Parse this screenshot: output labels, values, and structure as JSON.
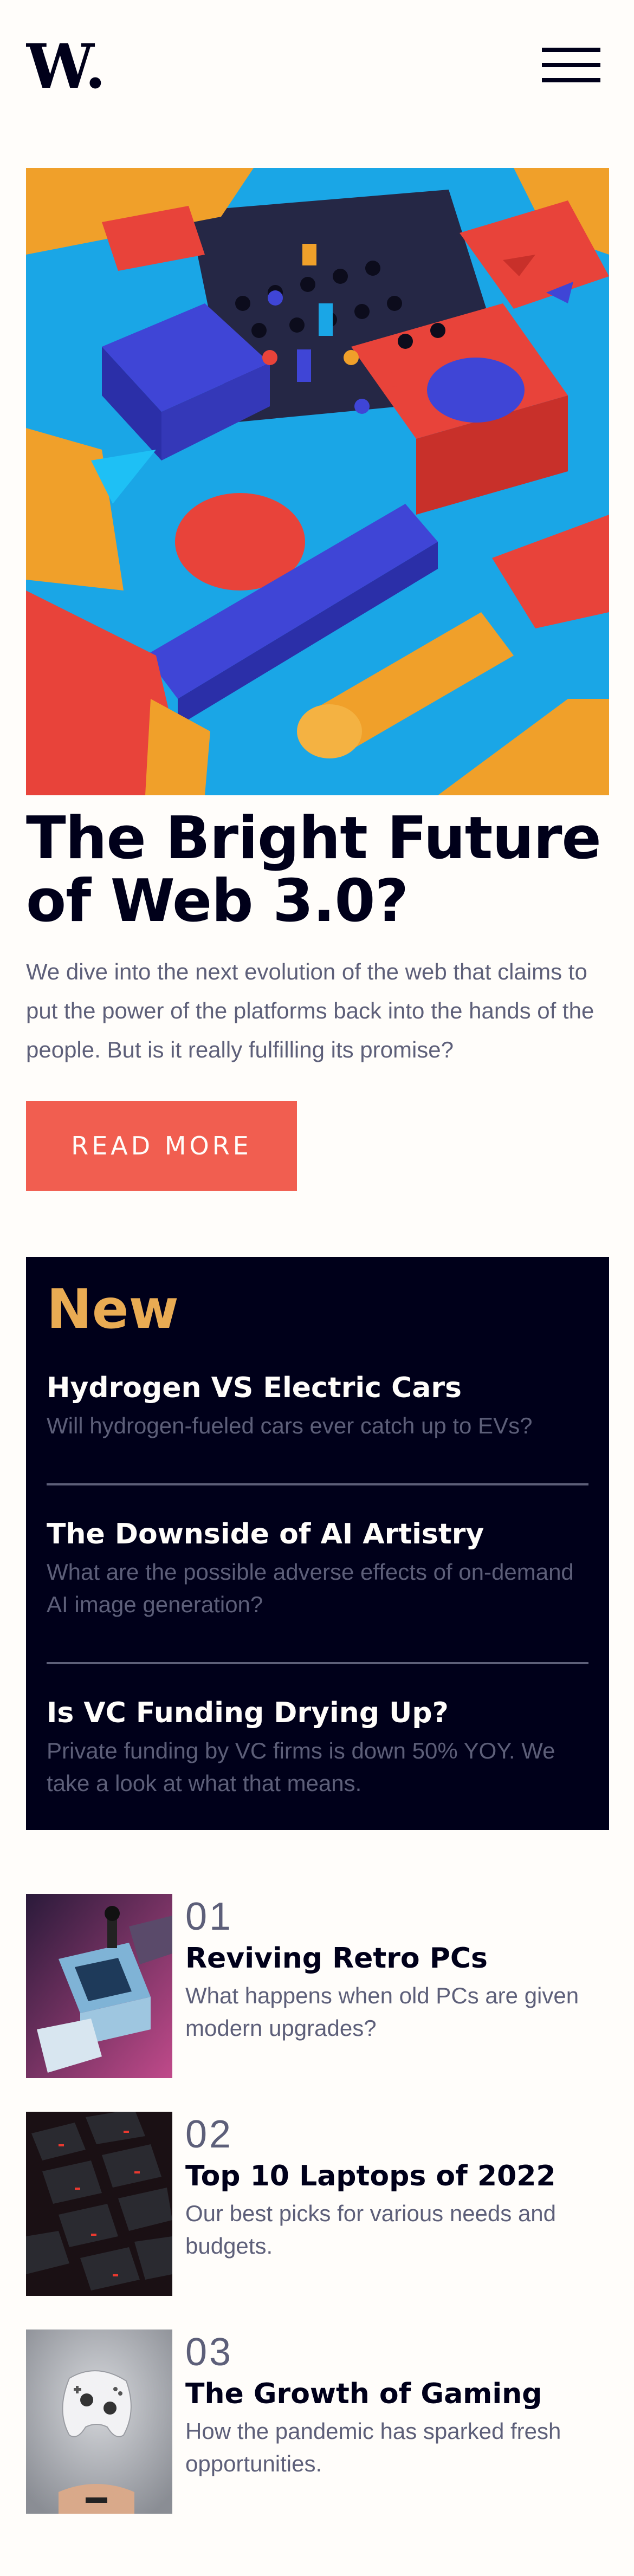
{
  "header": {
    "logo": "W.",
    "menu_icon": "hamburger-menu-icon"
  },
  "hero": {
    "image_icon": "abstract-3d-blocks-illustration",
    "title": "The Bright Future of Web 3.0?",
    "description": "We dive into the next evolution of the web that claims to put the power of the platforms back into the hands of the people. But is it really fulfilling its promise?",
    "cta_label": "READ MORE"
  },
  "new_panel": {
    "heading": "New",
    "items": [
      {
        "title": "Hydrogen VS Electric Cars",
        "summary": "Will hydrogen-fueled cars ever catch up to EVs?"
      },
      {
        "title": "The Downside of AI Artistry",
        "summary": "What are the possible adverse effects of on-demand AI image generation?"
      },
      {
        "title": "Is VC Funding Drying Up?",
        "summary": "Private funding by VC firms is down 50% YOY. We take a look at what that means."
      }
    ]
  },
  "top_articles": [
    {
      "number": "01",
      "title": "Reviving Retro PCs",
      "summary": "What happens when old PCs are given modern upgrades?",
      "image_icon": "retro-pc-photo"
    },
    {
      "number": "02",
      "title": "Top 10 Laptops of 2022",
      "summary": "Our best picks for various needs and budgets.",
      "image_icon": "laptop-keyboard-photo"
    },
    {
      "number": "03",
      "title": "The Growth of Gaming",
      "summary": "How the pandemic has sparked fresh opportunities.",
      "image_icon": "game-controller-photo"
    }
  ],
  "colors": {
    "background": "#fffdfa",
    "dark_navy": "#00001a",
    "grayish_blue": "#5d5f79",
    "soft_red": "#f15e50",
    "soft_orange": "#e9ab53"
  }
}
